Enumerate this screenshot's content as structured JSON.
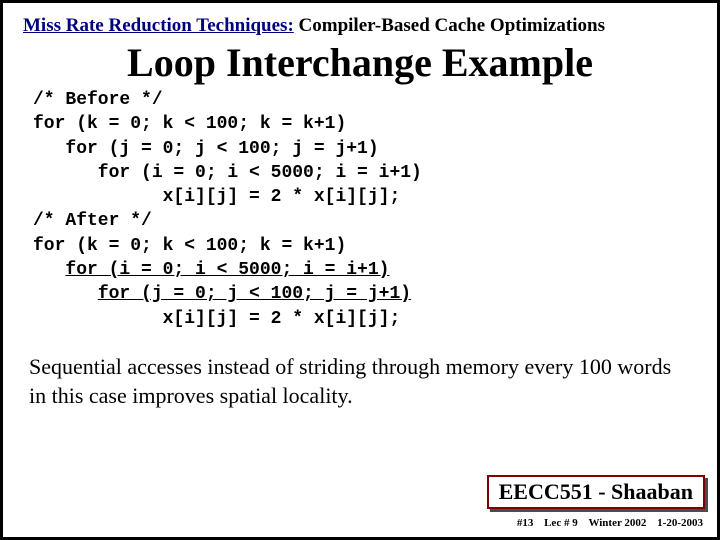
{
  "header": {
    "left": "Miss Rate Reduction Techniques:",
    "right": "Compiler-Based Cache Optimizations"
  },
  "title": "Loop Interchange Example",
  "code": {
    "before_comment": "/* Before */",
    "b_k": "for (k = 0; k < 100; k = k+1)",
    "b_j": "   for (j = 0; j < 100; j = j+1)",
    "b_i": "      for (i = 0; i < 5000; i = i+1)",
    "b_body": "            x[i][j] = 2 * x[i][j];",
    "after_comment": "/* After */",
    "a_k": "for (k = 0; k < 100; k = k+1)",
    "a_i_pre": "   ",
    "a_i": "for (i = 0; i < 5000; i = i+1)",
    "a_j_pre": "      ",
    "a_j": "for (j = 0; j < 100; j = j+1)",
    "a_body": "            x[i][j] = 2 * x[i][j];"
  },
  "explain": "Sequential accesses instead of striding through memory every 100 words in this case improves spatial locality.",
  "footer": {
    "course": "EECC551",
    "dash": " - ",
    "author": "Shaaban"
  },
  "tiny": {
    "slide_no": "#13",
    "lec": "Lec # 9",
    "term": "Winter 2002",
    "date": "1-20-2003"
  }
}
